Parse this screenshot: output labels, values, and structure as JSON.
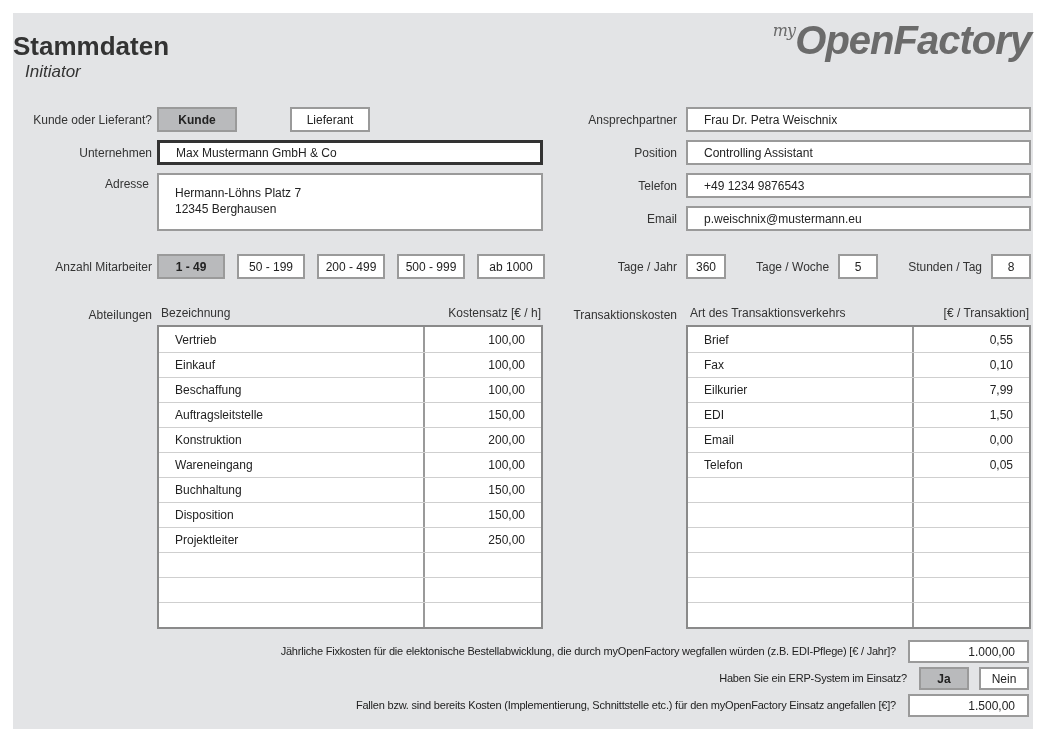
{
  "page": {
    "title": "Stammdaten",
    "subtitle": "Initiator"
  },
  "logo": {
    "prefix": "my",
    "name": "OpenFactory"
  },
  "role": {
    "label": "Kunde oder Lieferant?",
    "options": [
      {
        "label": "Kunde",
        "selected": true
      },
      {
        "label": "Lieferant",
        "selected": false
      }
    ]
  },
  "company": {
    "label": "Unternehmen",
    "value": "Max Mustermann GmbH & Co",
    "focused": true
  },
  "address": {
    "label": "Adresse",
    "lines": [
      "Hermann-Löhns Platz 7",
      "12345 Berghausen"
    ]
  },
  "contact_fields": [
    {
      "label": "Ansprechpartner",
      "value": "Frau Dr. Petra Weischnix"
    },
    {
      "label": "Position",
      "value": "Controlling Assistant"
    },
    {
      "label": "Telefon",
      "value": "+49 1234 9876543"
    },
    {
      "label": "Email",
      "value": "p.weischnix@mustermann.eu"
    }
  ],
  "employees": {
    "label": "Anzahl Mitarbeiter",
    "options": [
      {
        "label": "1 - 49",
        "selected": true
      },
      {
        "label": "50 - 199",
        "selected": false
      },
      {
        "label": "200 - 499",
        "selected": false
      },
      {
        "label": "500 - 999",
        "selected": false
      },
      {
        "label": "ab 1000",
        "selected": false
      }
    ]
  },
  "work_time": [
    {
      "label": "Tage / Jahr",
      "value": "360"
    },
    {
      "label": "Tage / Woche",
      "value": "5"
    },
    {
      "label": "Stunden / Tag",
      "value": "8"
    }
  ],
  "departments": {
    "label": "Abteilungen",
    "columns": [
      "Bezeichnung",
      "Kostensatz [€ / h]"
    ],
    "rows": [
      [
        "Vertrieb",
        "100,00"
      ],
      [
        "Einkauf",
        "100,00"
      ],
      [
        "Beschaffung",
        "100,00"
      ],
      [
        "Auftragsleitstelle",
        "150,00"
      ],
      [
        "Konstruktion",
        "200,00"
      ],
      [
        "Wareneingang",
        "100,00"
      ],
      [
        "Buchhaltung",
        "150,00"
      ],
      [
        "Disposition",
        "150,00"
      ],
      [
        "Projektleiter",
        "250,00"
      ]
    ]
  },
  "transaction_costs": {
    "label": "Transaktionskosten",
    "columns": [
      "Art des Transaktionsverkehrs",
      "[€ / Transaktion]"
    ],
    "rows": [
      [
        "Brief",
        "0,55"
      ],
      [
        "Fax",
        "0,10"
      ],
      [
        "Eilkurier",
        "7,99"
      ],
      [
        "EDI",
        "1,50"
      ],
      [
        "Email",
        "0,00"
      ],
      [
        "Telefon",
        "0,05"
      ]
    ]
  },
  "questions": [
    {
      "kind": "field",
      "text": "Jährliche Fixkosten für die elektonische Bestellabwicklung, die durch myOpenFactory wegfallen würden (z.B. EDI-Pflege) [€ / Jahr]?",
      "value": "1.000,00"
    },
    {
      "kind": "choice",
      "text": "Haben Sie ein ERP-System im Einsatz?",
      "options": [
        {
          "label": "Ja",
          "selected": true
        },
        {
          "label": "Nein",
          "selected": false
        }
      ]
    },
    {
      "kind": "field",
      "text": "Fallen bzw. sind bereits Kosten (Implementierung, Schnittstelle etc.) für den myOpenFactory Einsatz angefallen [€]?",
      "value": "1.500,00"
    }
  ]
}
